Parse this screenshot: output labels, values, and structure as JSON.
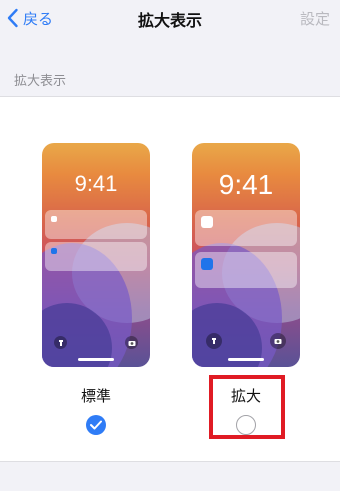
{
  "nav": {
    "back_label": "戻る",
    "title": "拡大表示",
    "right_label": "設定"
  },
  "section": {
    "header": "拡大表示"
  },
  "options": [
    {
      "label": "標準",
      "clock": "9:41",
      "selected": true
    },
    {
      "label": "拡大",
      "clock": "9:41",
      "selected": false
    }
  ],
  "colors": {
    "accent": "#2f7cf6",
    "highlight": "#e01b24"
  }
}
